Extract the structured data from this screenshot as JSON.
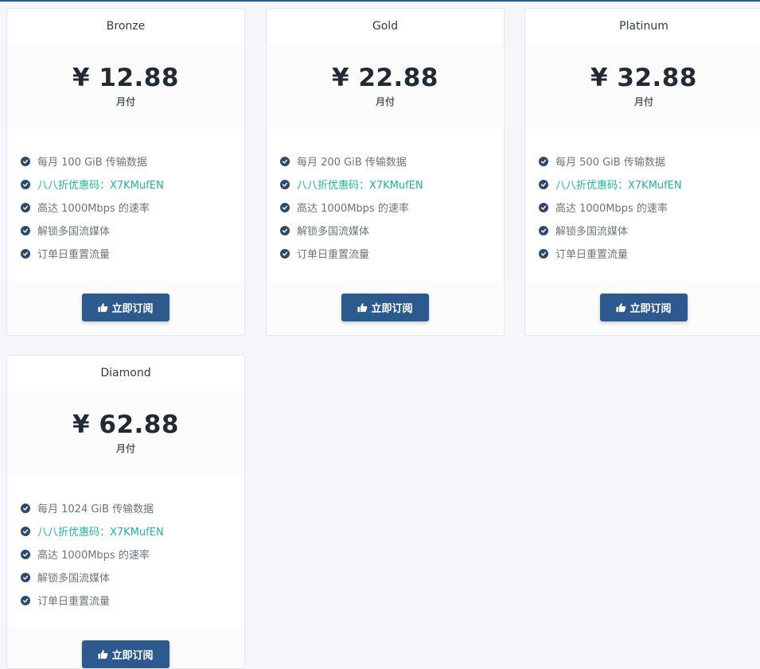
{
  "plans": [
    {
      "name": "Bronze",
      "price": "¥ 12.88",
      "period": "月付",
      "features": [
        {
          "text": "每月 100 GiB 传输数据",
          "promo": false
        },
        {
          "text": "八八折优惠码：X7KMufEN",
          "promo": true
        },
        {
          "text": "高达 1000Mbps 的速率",
          "promo": false
        },
        {
          "text": "解锁多国流媒体",
          "promo": false
        },
        {
          "text": "订单日重置流量",
          "promo": false
        }
      ],
      "button_label": "立即订阅"
    },
    {
      "name": "Gold",
      "price": "¥ 22.88",
      "period": "月付",
      "features": [
        {
          "text": "每月 200 GiB 传输数据",
          "promo": false
        },
        {
          "text": "八八折优惠码：X7KMufEN",
          "promo": true
        },
        {
          "text": "高达 1000Mbps 的速率",
          "promo": false
        },
        {
          "text": "解锁多国流媒体",
          "promo": false
        },
        {
          "text": "订单日重置流量",
          "promo": false
        }
      ],
      "button_label": "立即订阅"
    },
    {
      "name": "Platinum",
      "price": "¥ 32.88",
      "period": "月付",
      "features": [
        {
          "text": "每月 500 GiB 传输数据",
          "promo": false
        },
        {
          "text": "八八折优惠码：X7KMufEN",
          "promo": true
        },
        {
          "text": "高达 1000Mbps 的速率",
          "promo": false
        },
        {
          "text": "解锁多国流媒体",
          "promo": false
        },
        {
          "text": "订单日重置流量",
          "promo": false
        }
      ],
      "button_label": "立即订阅"
    },
    {
      "name": "Diamond",
      "price": "¥ 62.88",
      "period": "月付",
      "features": [
        {
          "text": "每月 1024 GiB 传输数据",
          "promo": false
        },
        {
          "text": "八八折优惠码：X7KMufEN",
          "promo": true
        },
        {
          "text": "高达 1000Mbps 的速率",
          "promo": false
        },
        {
          "text": "解锁多国流媒体",
          "promo": false
        },
        {
          "text": "订单日重置流量",
          "promo": false
        }
      ],
      "button_label": "立即订阅"
    }
  ],
  "icons": {
    "feature": "check-circle-icon",
    "button": "thumbs-up-icon"
  },
  "colors": {
    "primary": "#2c5a8f",
    "promo": "#1cb59b",
    "check": "#2d4a6e"
  }
}
